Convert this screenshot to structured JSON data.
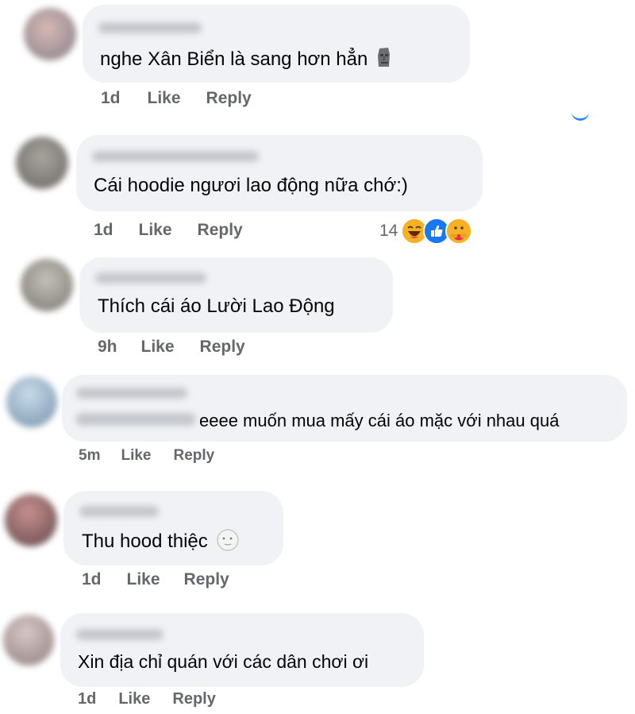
{
  "comments": [
    {
      "text": "nghe Xân Biển là sang hơn hẳn",
      "time": "1d",
      "like": "Like",
      "reply": "Reply",
      "emoji": "moai-icon"
    },
    {
      "text": "Cái hoodie ngươi lao động nữa chớ:)",
      "time": "1d",
      "like": "Like",
      "reply": "Reply",
      "reaction_count": "14",
      "reactions": [
        "haha-icon",
        "like-icon",
        "care-icon"
      ]
    },
    {
      "text": "Thích cái áo Lười Lao Động",
      "time": "9h",
      "like": "Like",
      "reply": "Reply"
    },
    {
      "text": "eeee muốn mua mấy cái áo mặc với nhau quá",
      "time": "5m",
      "like": "Like",
      "reply": "Reply"
    },
    {
      "text": "Thu hood thiệc",
      "time": "1d",
      "like": "Like",
      "reply": "Reply",
      "emoji": "moon-face-icon"
    },
    {
      "text": "Xin địa chỉ quán với các dân chơi ơi",
      "time": "1d",
      "like": "Like",
      "reply": "Reply"
    }
  ],
  "colors": {
    "bubble": "#f0f2f5",
    "meta": "#65676b",
    "like_blue": "#1877f2",
    "haha_yellow": "#f7b125"
  }
}
